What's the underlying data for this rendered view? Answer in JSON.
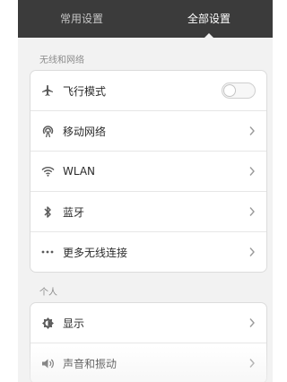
{
  "tabs": [
    {
      "label": "常用设置",
      "active": false
    },
    {
      "label": "全部设置",
      "active": true
    }
  ],
  "sections": [
    {
      "label": "无线和网络",
      "items": [
        {
          "label": "飞行模式",
          "icon": "airplane-icon",
          "control": "toggle",
          "toggle_on": false
        },
        {
          "label": "移动网络",
          "icon": "mobile-network-icon",
          "control": "chevron"
        },
        {
          "label": "WLAN",
          "icon": "wifi-icon",
          "control": "chevron"
        },
        {
          "label": "蓝牙",
          "icon": "bluetooth-icon",
          "control": "chevron"
        },
        {
          "label": "更多无线连接",
          "icon": "more-dots-icon",
          "control": "chevron"
        }
      ]
    },
    {
      "label": "个人",
      "items": [
        {
          "label": "显示",
          "icon": "brightness-icon",
          "control": "chevron"
        },
        {
          "label": "声音和振动",
          "icon": "speaker-icon",
          "control": "chevron"
        }
      ]
    }
  ],
  "colors": {
    "tabbar_bg": "#3b3b3b",
    "page_bg": "#f2f2f2",
    "icon": "#5a5a5a",
    "chevron": "#9a9a9a"
  }
}
